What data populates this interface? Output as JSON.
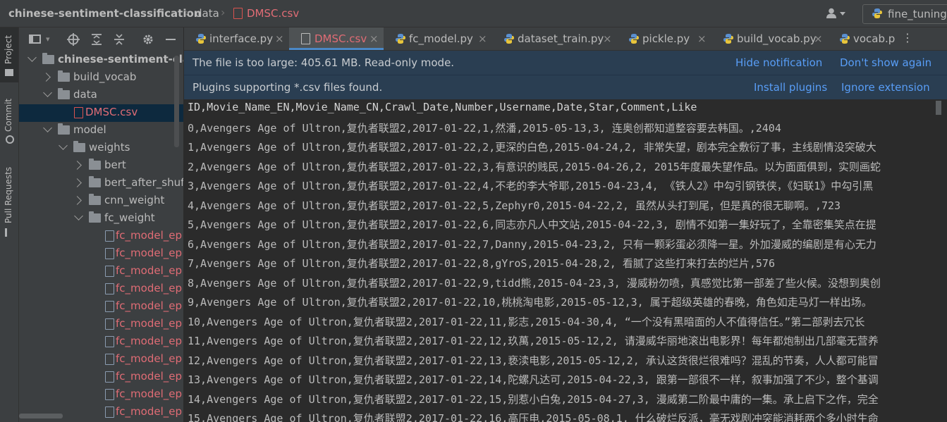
{
  "breadcrumb": {
    "project": "chinese-sentiment-classification",
    "folder": "data",
    "file": "DMSC.csv"
  },
  "run_config": {
    "label": "fine_tuning"
  },
  "left_strip": {
    "project": "Project",
    "commit": "Commit",
    "pull_requests": "Pull Requests"
  },
  "tree": [
    {
      "label": "chinese-sentiment-classification",
      "indent": 0,
      "arrow": "down",
      "kind": "folder"
    },
    {
      "label": "build_vocab",
      "indent": 1,
      "arrow": "right",
      "kind": "folder"
    },
    {
      "label": "data",
      "indent": 1,
      "arrow": "down",
      "kind": "folder"
    },
    {
      "label": "DMSC.csv",
      "indent": 2,
      "arrow": "",
      "kind": "csv",
      "selected": true
    },
    {
      "label": "model",
      "indent": 1,
      "arrow": "down",
      "kind": "folder"
    },
    {
      "label": "weights",
      "indent": 2,
      "arrow": "down",
      "kind": "folder"
    },
    {
      "label": "bert",
      "indent": 3,
      "arrow": "right",
      "kind": "folder"
    },
    {
      "label": "bert_after_shuffle",
      "indent": 3,
      "arrow": "right",
      "kind": "folder"
    },
    {
      "label": "cnn_weight",
      "indent": 3,
      "arrow": "right",
      "kind": "folder"
    },
    {
      "label": "fc_weight",
      "indent": 3,
      "arrow": "down",
      "kind": "folder"
    },
    {
      "label": "fc_model_ep",
      "indent": 4,
      "arrow": "",
      "kind": "redfile"
    },
    {
      "label": "fc_model_ep",
      "indent": 4,
      "arrow": "",
      "kind": "redfile"
    },
    {
      "label": "fc_model_ep",
      "indent": 4,
      "arrow": "",
      "kind": "redfile"
    },
    {
      "label": "fc_model_ep",
      "indent": 4,
      "arrow": "",
      "kind": "redfile"
    },
    {
      "label": "fc_model_ep",
      "indent": 4,
      "arrow": "",
      "kind": "redfile"
    },
    {
      "label": "fc_model_ep",
      "indent": 4,
      "arrow": "",
      "kind": "redfile"
    },
    {
      "label": "fc_model_ep",
      "indent": 4,
      "arrow": "",
      "kind": "redfile"
    },
    {
      "label": "fc_model_ep",
      "indent": 4,
      "arrow": "",
      "kind": "redfile"
    },
    {
      "label": "fc_model_ep",
      "indent": 4,
      "arrow": "",
      "kind": "redfile"
    },
    {
      "label": "fc_model_ep",
      "indent": 4,
      "arrow": "",
      "kind": "redfile"
    },
    {
      "label": "fc_model_ep",
      "indent": 4,
      "arrow": "",
      "kind": "redfile"
    }
  ],
  "tabs": [
    {
      "label": "interface.py",
      "type": "py",
      "close": true
    },
    {
      "label": "DMSC.csv",
      "type": "csv",
      "close": true,
      "active": true
    },
    {
      "label": "fc_model.py",
      "type": "py",
      "close": true
    },
    {
      "label": "dataset_train.py",
      "type": "py",
      "close": true
    },
    {
      "label": "pickle.py",
      "type": "py",
      "close": true
    },
    {
      "label": "build_vocab.py",
      "type": "py",
      "close": true
    },
    {
      "label": "vocab.p",
      "type": "py",
      "close": false
    }
  ],
  "notifications": [
    {
      "text": "The file is too large: 405.61 MB. Read-only mode.",
      "links": [
        "Hide notification",
        "Don't show again"
      ]
    },
    {
      "text": "Plugins supporting *.csv files found.",
      "links": [
        "Install plugins",
        "Ignore extension"
      ]
    }
  ],
  "lines": [
    "ID,Movie_Name_EN,Movie_Name_CN,Crawl_Date,Number,Username,Date,Star,Comment,Like",
    "0,Avengers Age of Ultron,复仇者联盟2,2017-01-22,1,然潘,2015-05-13,3, 连奥创都知道整容要去韩国。,2404",
    "1,Avengers Age of Ultron,复仇者联盟2,2017-01-22,2,更深的白色,2015-04-24,2, 非常失望，剧本完全敷衍了事，主线剧情没突破大",
    "2,Avengers Age of Ultron,复仇者联盟2,2017-01-22,3,有意识的贱民,2015-04-26,2, 2015年度最失望作品。以为面面俱到，实则画蛇",
    "3,Avengers Age of Ultron,复仇者联盟2,2017-01-22,4,不老的李大爷耶,2015-04-23,4, 《铁人2》中勾引钢铁侠，《妇联1》中勾引黑",
    "4,Avengers Age of Ultron,复仇者联盟2,2017-01-22,5,Zephyr0,2015-04-22,2, 虽然从头打到尾，但是真的很无聊啊。,723",
    "5,Avengers Age of Ultron,复仇者联盟2,2017-01-22,6,同志亦凡人中文站,2015-04-22,3, 剧情不如第一集好玩了，全靠密集笑点在提",
    "6,Avengers Age of Ultron,复仇者联盟2,2017-01-22,7,Danny,2015-04-23,2, 只有一颗彩蛋必须降一星。外加漫威的编剧是有心无力",
    "7,Avengers Age of Ultron,复仇者联盟2,2017-01-22,8,gYroS,2015-04-28,2, 看腻了这些打来打去的烂片,576",
    "8,Avengers Age of Ultron,复仇者联盟2,2017-01-22,9,tidd熊,2015-04-23,3, 漫威粉勿喷，真感觉比第一部差了些火候。没想到奥创",
    "9,Avengers Age of Ultron,复仇者联盟2,2017-01-22,10,桃桃淘电影,2015-05-12,3, 属于超级英雄的春晚，角色如走马灯一样出场。",
    "10,Avengers Age of Ultron,复仇者联盟2,2017-01-22,11,影志,2015-04-30,4, “一个没有黑暗面的人不值得信任。”第二部剥去冗长",
    "11,Avengers Age of Ultron,复仇者联盟2,2017-01-22,12,玖萬,2015-05-12,2, 请漫威华丽地滚出电影界！每年都炮制出几部毫无营养",
    "12,Avengers Age of Ultron,复仇者联盟2,2017-01-22,13,亵渎电影,2015-05-12,2, 承认这货很烂很难吗？混乱的节奏，人人都可能冒",
    "13,Avengers Age of Ultron,复仇者联盟2,2017-01-22,14,陀螺凡达可,2015-04-22,3, 跟第一部很不一样，叙事加强了不少，整个基调",
    "14,Avengers Age of Ultron,复仇者联盟2,2017-01-22,15,别惹小白兔,2015-04-27,3, 漫威第二阶最中庸的一集。承上启下之作，完全",
    "15,Avengers Age of Ultron,复仇者联盟2,2017-01-22,16,高压电,2015-05-08,1, 什么破烂反派，毫无戏剧冲突能消耗两个多小时生命"
  ]
}
